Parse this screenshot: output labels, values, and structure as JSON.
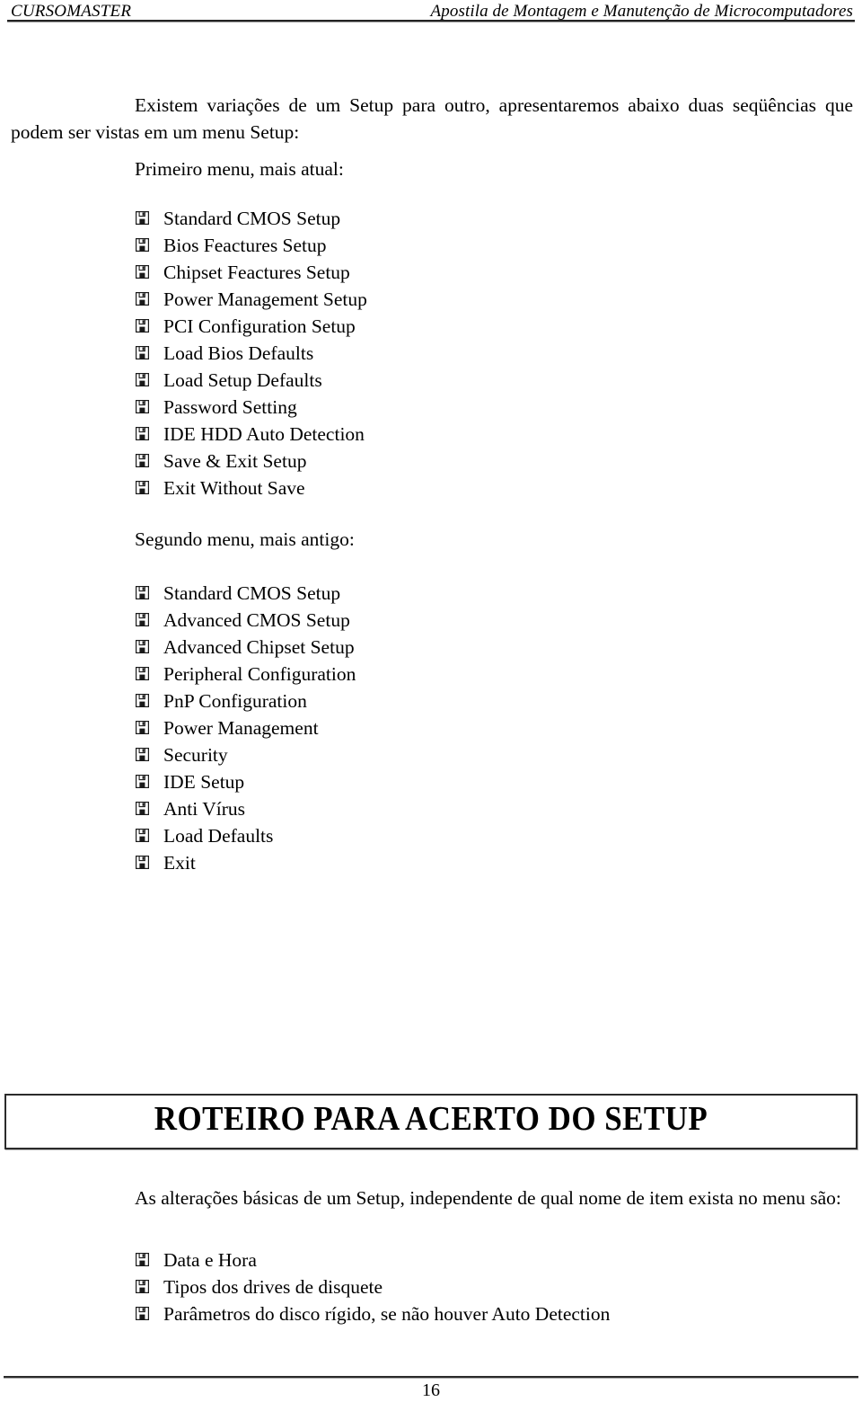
{
  "header": {
    "left": "CURSOMASTER",
    "right": "Apostila de Montagem e Manutenção de Microcomputadores"
  },
  "intro_paragraph": "Existem variações de um Setup para outro, apresentaremos abaixo duas seqüências que podem ser vistas em um menu Setup:",
  "first_menu": {
    "heading": "Primeiro menu, mais atual:",
    "bullet_icon": "floppy-disk-icon",
    "items": [
      "Standard CMOS Setup",
      "Bios Feactures Setup",
      "Chipset Feactures Setup",
      "Power Management Setup",
      "PCI Configuration Setup",
      "Load Bios Defaults",
      "Load Setup Defaults",
      "Password Setting",
      "IDE HDD Auto Detection",
      "Save & Exit Setup",
      "Exit Without Save"
    ]
  },
  "second_menu": {
    "heading": "Segundo menu, mais antigo:",
    "bullet_icon": "floppy-disk-icon",
    "items": [
      "Standard CMOS Setup",
      "Advanced CMOS Setup",
      "Advanced Chipset Setup",
      "Peripheral Configuration",
      "PnP Configuration",
      "Power Management",
      "Security",
      "IDE Setup",
      "Anti Vírus",
      "Load Defaults",
      "Exit"
    ]
  },
  "section_title": "ROTEIRO PARA ACERTO DO SETUP",
  "section_paragraph": "As alterações básicas de um Setup, independente de qual nome de item exista no menu são:",
  "changes_list": {
    "bullet_icon": "floppy-disk-icon",
    "items": [
      "Data e Hora",
      "Tipos dos drives de disquete",
      "Parâmetros do disco rígido, se não houver Auto Detection"
    ]
  },
  "footer": {
    "page_number": "16"
  },
  "colors": {
    "text": "#000000",
    "rule": "#2b2b2b",
    "page_background": "#ffffff"
  }
}
